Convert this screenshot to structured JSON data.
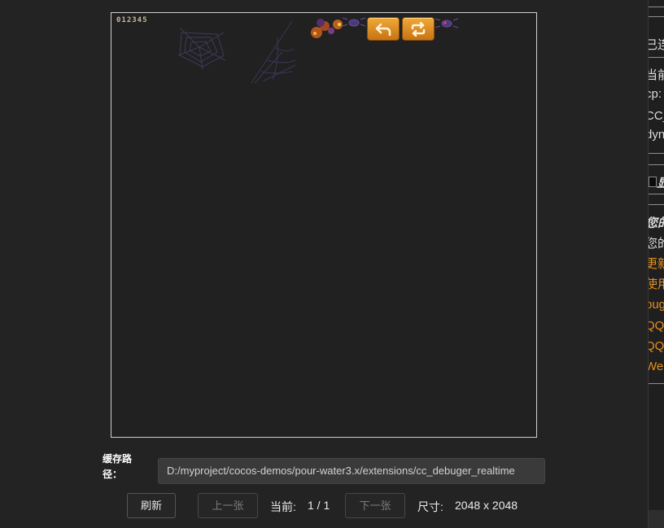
{
  "preview": {
    "score_digits": "012345"
  },
  "cache_path": {
    "label": "缓存路径：",
    "value": "D:/myproject/cocos-demos/pour-water3.x/extensions/cc_debuger_realtime"
  },
  "controls": {
    "refresh_label": "刷新",
    "prev_label": "上一张",
    "current_label": "当前:",
    "current_value": "1 / 1",
    "next_label": "下一张",
    "size_label": "尺寸:",
    "size_value": "2048 x 2048"
  },
  "side_panel": {
    "lines": [
      {
        "text": "已连",
        "style": "normal"
      },
      {
        "text": "当前",
        "style": "normal"
      },
      {
        "text": "cp:",
        "style": "normal"
      },
      {
        "text": "CC_",
        "style": "normal"
      },
      {
        "text": "dyn",
        "style": "normal"
      },
      {
        "text": "显",
        "style": "bold"
      },
      {
        "text": "您的",
        "style": "bold"
      },
      {
        "text": "您的",
        "style": "normal"
      },
      {
        "text": "更新",
        "style": "orange"
      },
      {
        "text": "使用",
        "style": "orange"
      },
      {
        "text": "bug",
        "style": "orange"
      },
      {
        "text": "QQ",
        "style": "orange"
      },
      {
        "text": "QQ",
        "style": "orange"
      },
      {
        "text": "We",
        "style": "orange"
      }
    ]
  },
  "colors": {
    "accent_orange": "#e8901e",
    "sprite_button": "#e0952a"
  }
}
